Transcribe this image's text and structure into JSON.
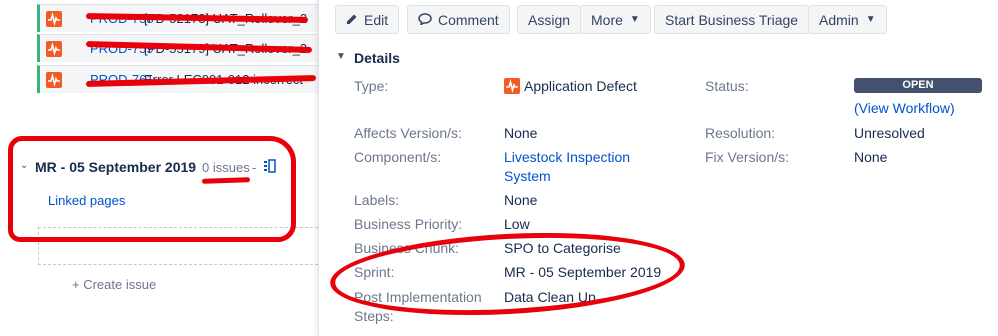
{
  "left": {
    "issue_rows": [
      {
        "key": "PROD-758",
        "summary": "[FD-52173] UAT_Rollover_2"
      },
      {
        "key": "PROD-759",
        "summary": "[FD-55179] UAT_Rollover_2"
      },
      {
        "key": "PROD-761",
        "summary": "Error LEC001-012 incorrect"
      }
    ],
    "sprint": {
      "name": "MR - 05 September 2019",
      "issues": "0 issues",
      "separator": "-",
      "linked_pages": "Linked pages",
      "create_issue": "+   Create issue"
    }
  },
  "toolbar": {
    "edit": "Edit",
    "comment": "Comment",
    "assign": "Assign",
    "more": "More",
    "start_triage": "Start Business Triage",
    "admin": "Admin"
  },
  "details": {
    "title": "Details",
    "type_label": "Type:",
    "type_value": "Application Defect",
    "status_label": "Status:",
    "status_value": "OPEN",
    "view_workflow_open": "(",
    "view_workflow": "View Workflow",
    "view_workflow_close": ")",
    "affects_label": "Affects Version/s:",
    "affects_value": "None",
    "resolution_label": "Resolution:",
    "resolution_value": "Unresolved",
    "component_label": "Component/s:",
    "component_value_line1": "Livestock Inspection",
    "component_value_line2": "System",
    "fix_label": "Fix Version/s:",
    "fix_value": "None",
    "labels_label": "Labels:",
    "labels_value": "None",
    "priority_label": "Business Priority:",
    "priority_value": "Low",
    "chunk_label": "Business Chunk:",
    "chunk_value": "SPO to Categorise",
    "sprint_label": "Sprint:",
    "sprint_value": "MR - 05 September 2019",
    "post_impl_label_line1": "Post Implementation",
    "post_impl_label_line2": "Steps:",
    "post_impl_value": "Data Clean Up"
  },
  "colors": {
    "annotation_red": "#e8000b",
    "link_blue": "#0052cc",
    "defect_orange": "#f15c22",
    "status_badge": "#42526e",
    "row_accent_green": "#36b37e"
  },
  "icons": {
    "defect": "application-defect-icon",
    "edit": "pencil-icon",
    "comment": "speech-bubble-icon",
    "board": "board-columns-icon",
    "chevron": "chevron-down-icon"
  }
}
